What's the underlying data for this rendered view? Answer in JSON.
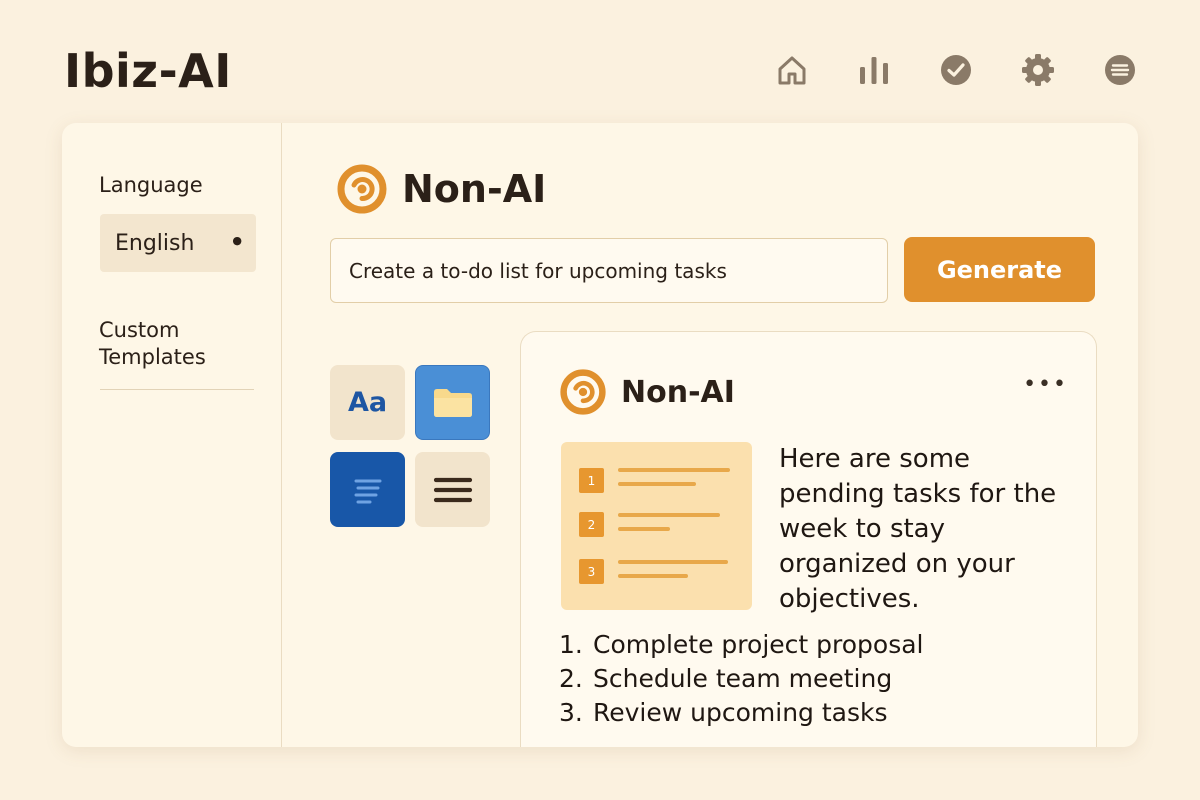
{
  "app": {
    "title": "Ibiz-AI"
  },
  "nav": [
    {
      "name": "home-icon"
    },
    {
      "name": "bar-chart-icon"
    },
    {
      "name": "check-circle-icon"
    },
    {
      "name": "gear-icon"
    },
    {
      "name": "menu-circle-icon"
    }
  ],
  "sidebar": {
    "language_label": "Language",
    "language_value": "English",
    "templates_label": "Custom Templates"
  },
  "main": {
    "brand_name": "Non-AI",
    "prompt_value": "Create a to-do list for upcoming tasks",
    "generate_label": "Generate",
    "tools": {
      "font_label": "Aa"
    }
  },
  "result": {
    "brand_name": "Non-AI",
    "more_label": "•••",
    "summary": "Here are some pending tasks for the week to stay organized on your objectives.",
    "illustration_numbers": [
      "1",
      "2",
      "3"
    ],
    "tasks": [
      {
        "num": "1.",
        "text": "Complete project proposal"
      },
      {
        "num": "2.",
        "text": "Schedule team meeting"
      },
      {
        "num": "3.",
        "text": "Review upcoming tasks"
      }
    ]
  },
  "colors": {
    "background": "#fbf1df",
    "accent": "#e0902d",
    "card": "#fef7e7",
    "blue": "#1857a8"
  }
}
